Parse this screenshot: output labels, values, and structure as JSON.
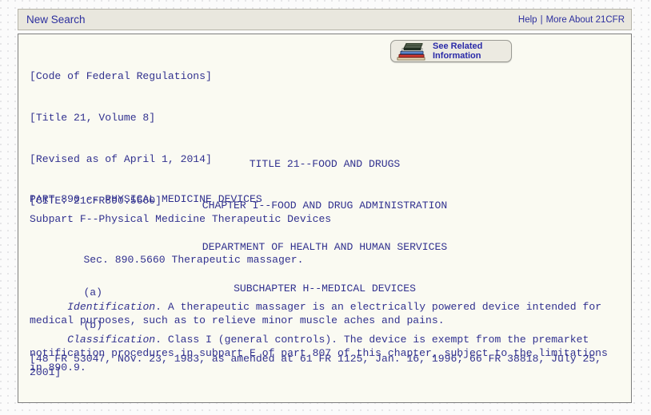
{
  "navbar": {
    "new_search_label": "New Search",
    "help_label": "Help",
    "separator": "|",
    "more_about_label": "More About 21CFR",
    "link_color": "#2c2f9e",
    "background_color": "#e9e7de"
  },
  "related_button": {
    "icon": "stack-of-books-icon",
    "line1": "See Related",
    "line2": "Information",
    "text_color": "#2929a8",
    "background_color": "#eceae1"
  },
  "document": {
    "text_color": "#31318f",
    "background_color": "#fafaf2",
    "header_lines": [
      "[Code of Federal Regulations]",
      "[Title 21, Volume 8]",
      "[Revised as of April 1, 2014]",
      "[CITE: 21CFR890.5660]"
    ],
    "title_lines": [
      "TITLE 21--FOOD AND DRUGS",
      "CHAPTER I--FOOD AND DRUG ADMINISTRATION",
      "DEPARTMENT OF HEALTH AND HUMAN SERVICES",
      "SUBCHAPTER H--MEDICAL DEVICES"
    ],
    "part_line": "PART 890 -- PHYSICAL MEDICINE DEVICES",
    "subpart_line": "Subpart F--Physical Medicine Therapeutic Devices",
    "section_line": "Sec. 890.5660 Therapeutic massager.",
    "paragraph_a": {
      "marker": "(a)",
      "term": "Identification",
      "body": ". A therapeutic massager is an electrically powered device intended for medical purposes, such as to relieve minor muscle aches and pains."
    },
    "paragraph_b": {
      "marker": "(b)",
      "term": "Classification",
      "body": ". Class I (general controls). The device is exempt from the premarket notification procedures in subpart E of part 807 of this chapter, subject to the limitations in 890.9."
    },
    "citation": "[48 FR 53047, Nov. 23, 1983, as amended at 61 FR 1125, Jan. 16, 1996; 66 FR 38818, July 25, 2001]"
  }
}
